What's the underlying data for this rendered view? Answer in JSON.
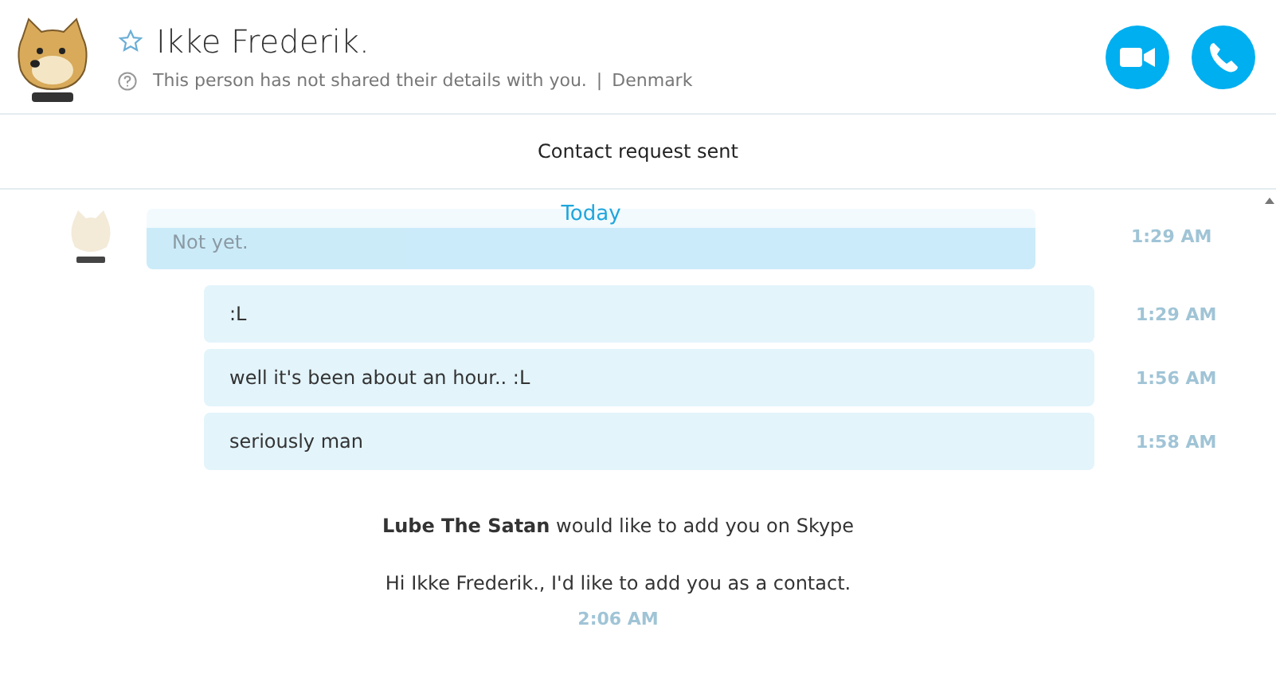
{
  "contact": {
    "name": "Ikke Frederik.",
    "favorite": false,
    "details": "This person has not shared their details with you.",
    "separator": "|",
    "location": "Denmark"
  },
  "banner": "Contact request sent",
  "day_divider": "Today",
  "faded_message": {
    "text": "Not yet.",
    "time": "1:29 AM"
  },
  "messages": [
    {
      "text": ":L",
      "time": "1:29 AM"
    },
    {
      "text": "well it's been about an hour.. :L",
      "time": "1:56 AM"
    },
    {
      "text": "seriously man",
      "time": "1:58 AM"
    }
  ],
  "request": {
    "title": "**Lube The Satan** would like to add you on Skype",
    "message": "Hi Ikke Frederik., I'd like to add you as a contact.",
    "time": "2:06 AM"
  }
}
